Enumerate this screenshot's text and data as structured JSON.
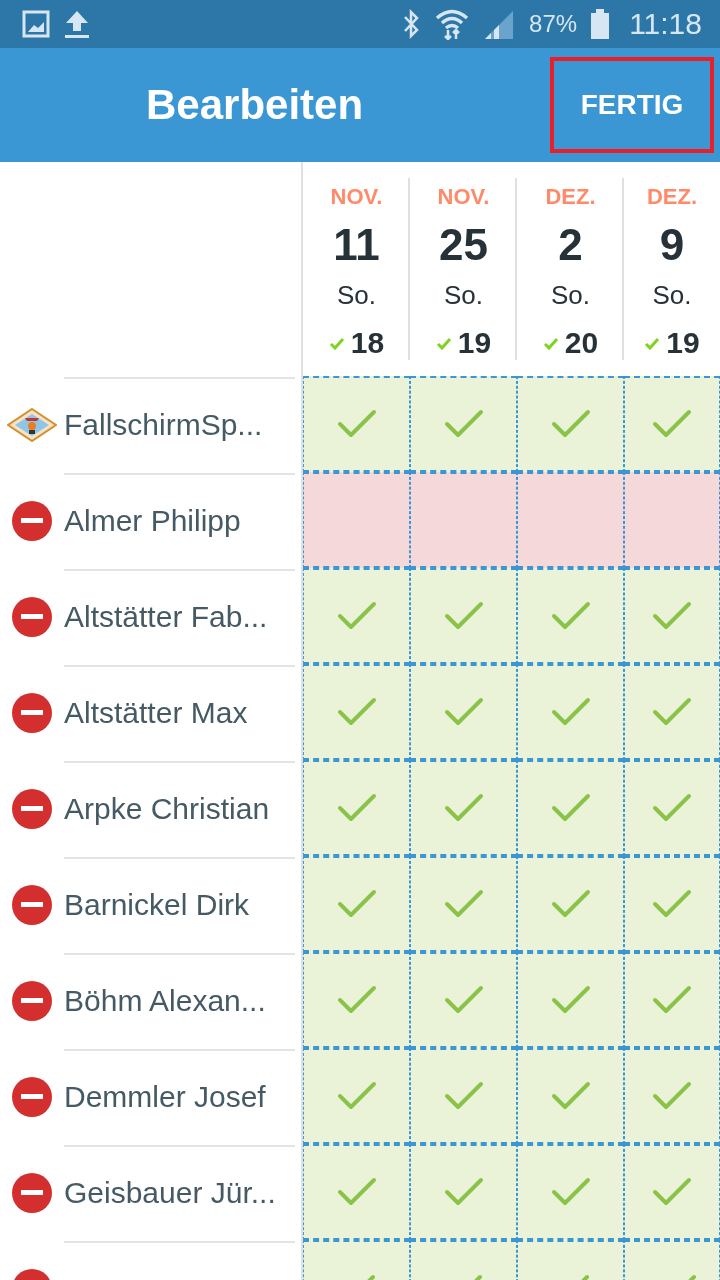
{
  "status_bar": {
    "battery": "87%",
    "time": "11:18"
  },
  "header": {
    "title": "Bearbeiten",
    "done_button": {
      "label": "FERTIG",
      "highlighted": true
    }
  },
  "dates": [
    {
      "month": "NOV.",
      "day": "11",
      "weekday": "So.",
      "count": "18"
    },
    {
      "month": "NOV.",
      "day": "25",
      "weekday": "So.",
      "count": "19"
    },
    {
      "month": "DEZ.",
      "day": "2",
      "weekday": "So.",
      "count": "20"
    },
    {
      "month": "DEZ.",
      "day": "9",
      "weekday": "So.",
      "count": "19"
    }
  ],
  "rows": [
    {
      "kind": "group",
      "name": "FallschirmSp...",
      "attending": [
        true,
        true,
        true,
        true
      ]
    },
    {
      "kind": "member",
      "name": "Almer Philipp",
      "attending": [
        false,
        false,
        false,
        false
      ]
    },
    {
      "kind": "member",
      "name": "Altstätter Fab...",
      "attending": [
        true,
        true,
        true,
        true
      ]
    },
    {
      "kind": "member",
      "name": "Altstätter Max",
      "attending": [
        true,
        true,
        true,
        true
      ]
    },
    {
      "kind": "member",
      "name": "Arpke Christian",
      "attending": [
        true,
        true,
        true,
        true
      ]
    },
    {
      "kind": "member",
      "name": "Barnickel Dirk",
      "attending": [
        true,
        true,
        true,
        true
      ]
    },
    {
      "kind": "member",
      "name": "Böhm Alexan...",
      "attending": [
        true,
        true,
        true,
        true
      ]
    },
    {
      "kind": "member",
      "name": "Demmler Josef",
      "attending": [
        true,
        true,
        true,
        true
      ]
    },
    {
      "kind": "member",
      "name": "Geisbauer Jür...",
      "attending": [
        true,
        true,
        true,
        true
      ]
    },
    {
      "kind": "member",
      "attending": [
        true,
        true,
        true,
        true
      ]
    }
  ]
}
